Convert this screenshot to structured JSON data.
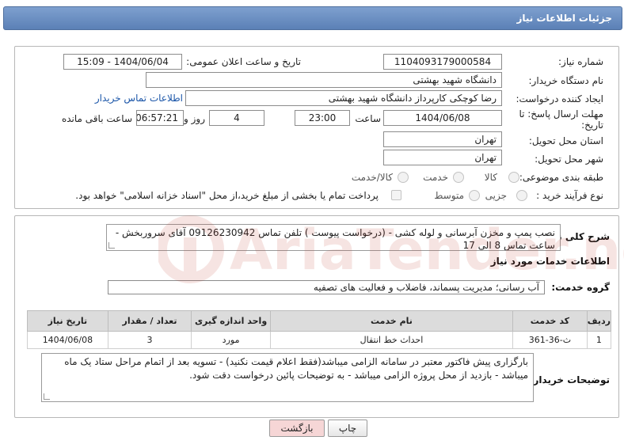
{
  "header": {
    "title": "جزئیات اطلاعات نیاز"
  },
  "form": {
    "need_number": {
      "label": "شماره نیاز:",
      "value": "1104093179000584"
    },
    "announce_datetime": {
      "label": "تاریخ و ساعت اعلان عمومی:",
      "value": "1404/06/04 - 15:09"
    },
    "buyer_org": {
      "label": "نام دستگاه خریدار:",
      "value": "دانشگاه شهید بهشتی"
    },
    "requester": {
      "label": "ایجاد کننده درخواست:",
      "value": "رضا کوچکی کارپرداز دانشگاه شهید بهشتی",
      "contact_link": "اطلاعات تماس خریدار"
    },
    "deadline": {
      "label_line1": "مهلت ارسال پاسخ: تا",
      "label_line2": "تاریخ:",
      "date": "1404/06/08",
      "time_label": "ساعت",
      "time": "23:00",
      "days": "4",
      "days_label": "روز و",
      "remaining": "06:57:21",
      "remaining_label": "ساعت باقی مانده"
    },
    "province": {
      "label": "استان محل تحویل:",
      "value": "تهران"
    },
    "city": {
      "label": "شهر محل تحویل:",
      "value": "تهران"
    },
    "category": {
      "label": "طبقه بندی موضوعی:",
      "options": [
        "کالا",
        "خدمت",
        "کالا/خدمت"
      ]
    },
    "purchase_process": {
      "label": "نوع فرآیند خرید :",
      "options": [
        "جزیی",
        "متوسط"
      ],
      "note": "پرداخت تمام یا بخشی از مبلغ خرید،از محل \"اسناد خزانه اسلامی\" خواهد بود."
    }
  },
  "summary": {
    "label": "شرح کلی نیاز:",
    "text": "نصب پمپ و مخزن آبرسانی و لوله کشی - (درخواست پیوست ) تلفن تماس 09126230942 آقای سروربخش - ساعت تماس 8 الی 17"
  },
  "services": {
    "section_title": "اطلاعات خدمات مورد نیاز",
    "group_label": "گروه خدمت:",
    "group_value": "آب رسانی؛ مدیریت پسماند، فاضلاب و فعالیت های تصفیه",
    "columns": [
      "ردیف",
      "کد خدمت",
      "نام خدمت",
      "واحد اندازه گیری",
      "تعداد / مقدار",
      "تاریخ نیاز"
    ],
    "rows": [
      {
        "index": "1",
        "code": "ث-36-361",
        "name": "احداث خط انتقال",
        "unit": "مورد",
        "qty": "3",
        "date": "1404/06/08"
      }
    ]
  },
  "buyer_notes": {
    "label": "توضیحات خریدار:",
    "text": "بارگزاری پیش فاکتور معتبر در سامانه الزامی میباشد(فقط اعلام قیمت نکنید) - تسویه بعد از اتمام مراحل ستاد یک ماه میباشد - بازدید از محل پروژه الزامی میباشد - به توضیحات پائین درخواست دقت شود."
  },
  "buttons": {
    "print": "چاپ",
    "back": "بازگشت"
  },
  "watermark": {
    "text": "AriaTender.net"
  },
  "colors": {
    "header_bg": "#5b80b6",
    "link": "#1a55a8",
    "back_btn_bg": "#f6d6d6"
  }
}
